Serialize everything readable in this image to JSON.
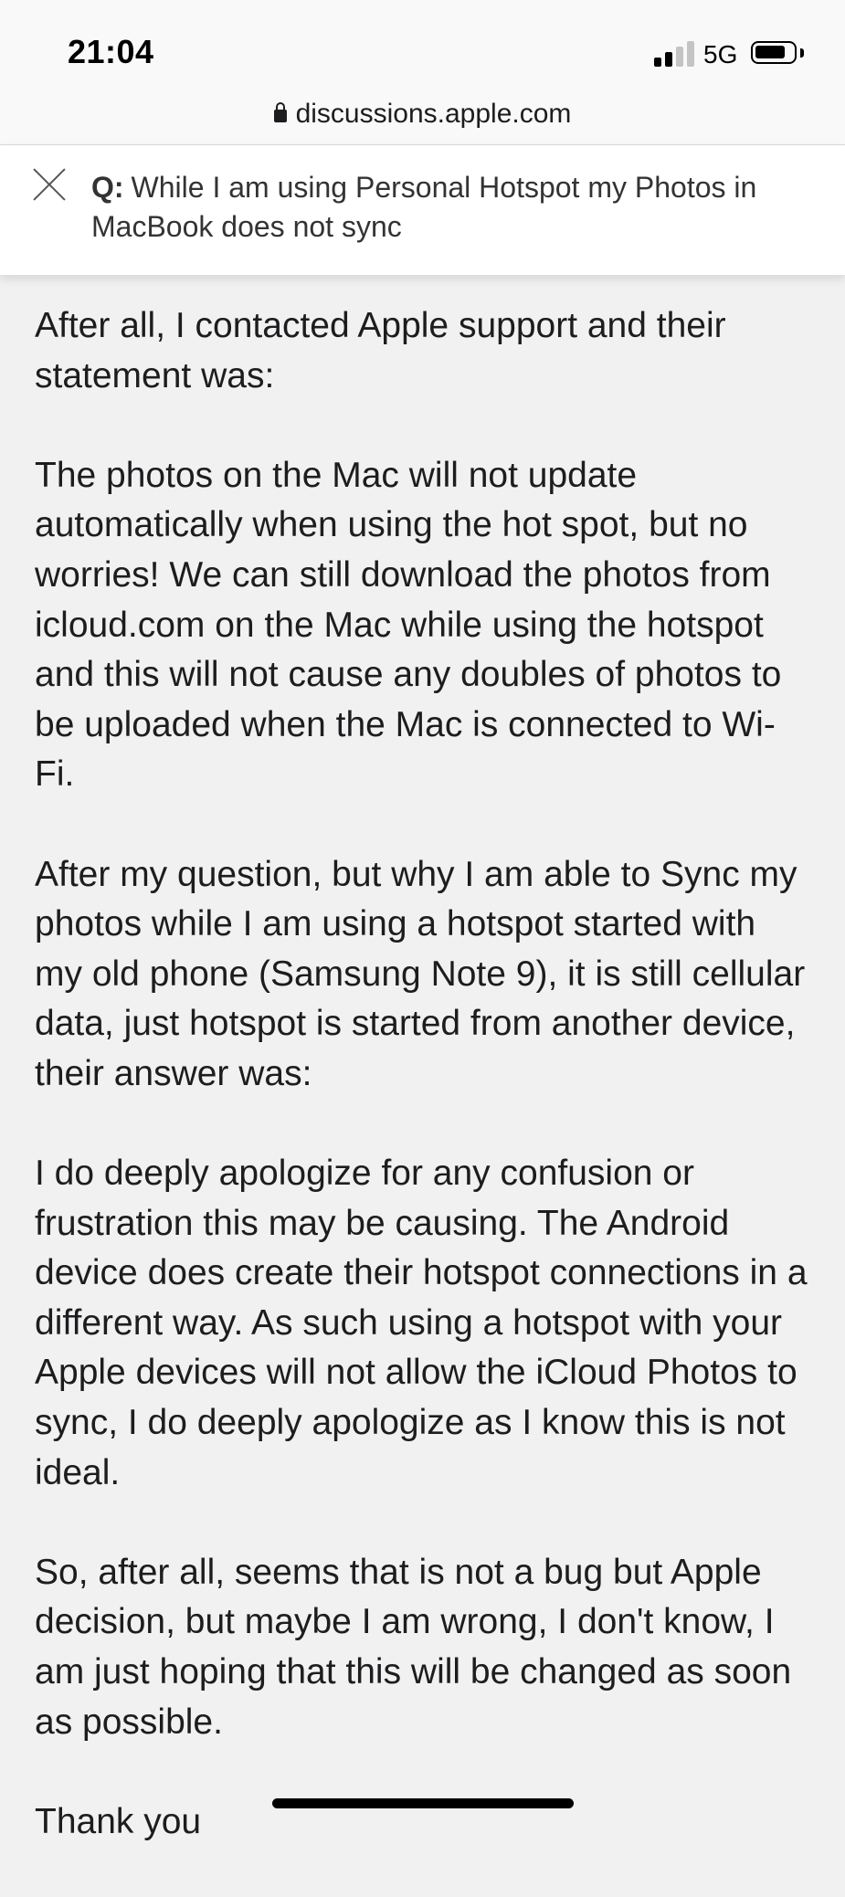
{
  "status_bar": {
    "time": "21:04",
    "network": "5G",
    "signal_bars_active": 2,
    "signal_bars_total": 4
  },
  "browser": {
    "url": "discussions.apple.com",
    "lock_icon": "lock-icon"
  },
  "question": {
    "prefix": "Q:",
    "title": "While I am using Personal Hotspot my Photos in MacBook does not sync",
    "close_icon": "close-icon"
  },
  "post": {
    "paragraphs": [
      "After all, I contacted Apple support and their statement was:",
      "The photos on the Mac will not update automatically when using the hot spot, but no worries! We can still download the photos from icloud.com on the Mac while using the hotspot and this will not cause any doubles of photos to be uploaded when the Mac is connected to Wi-Fi.",
      "After my question, but why I am able to Sync my photos while I am using a hotspot started with my old phone (Samsung Note 9), it is still cellular data, just hotspot is started from another device, their answer was:",
      "I do deeply apologize for any confusion or frustration this may be causing. The Android device does create their hotspot connections in a different way. As such using a hotspot with your Apple devices will not allow the iCloud Photos to sync, I do deeply apologize as I know this is not ideal.",
      "So, after all, seems that is not a bug but Apple decision, but maybe I am wrong, I don't know, I am just hoping that this will be changed as soon as possible.",
      "Thank you"
    ]
  },
  "colors": {
    "page_background": "#f1f1f1",
    "header_background": "#ffffff",
    "text": "#1d1d1f"
  }
}
